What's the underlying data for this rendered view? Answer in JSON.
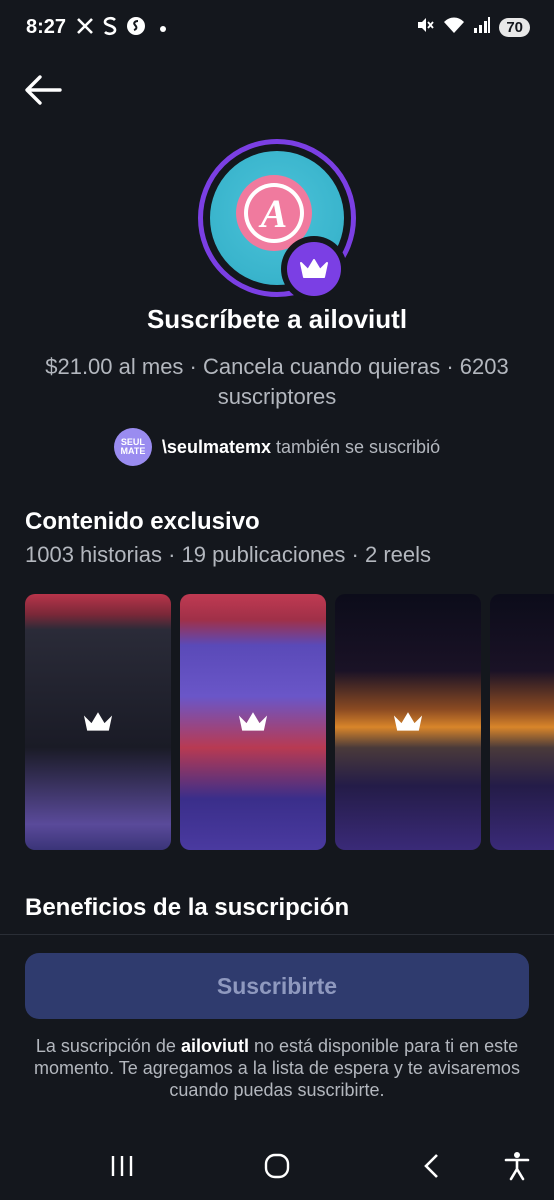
{
  "status_bar": {
    "time": "8:27",
    "left_icons": [
      "x-icon",
      "s-icon",
      "shazam-icon"
    ],
    "battery": "70"
  },
  "header": {
    "back_icon": "arrow-left-icon"
  },
  "profile": {
    "avatar_letter": "A",
    "badge_icon": "crown-icon",
    "title": "Suscríbete a ailoviutl",
    "price_line": "$21.00 al mes · Cancela cuando quieras · 6203 suscriptores",
    "also_subscribed": {
      "avatar_text": "SEUL MATE",
      "user": "\\seulmatemx",
      "text": "también se suscribió"
    }
  },
  "exclusive": {
    "title": "Contenido exclusivo",
    "subtitle": "1003 historias · 19 publicaciones · 2 reels",
    "thumb_icon": "crown-icon"
  },
  "benefits": {
    "title": "Beneficios de la suscripción"
  },
  "cta": {
    "button_label": "Suscribirte",
    "notice_before": "La suscripción de ",
    "notice_user": "ailoviutl",
    "notice_after": " no está disponible para ti en este momento. Te agregamos a la lista de espera y te avisaremos cuando puedas suscribirte."
  },
  "nav_bar": {
    "icons": [
      "recents-icon",
      "home-icon",
      "back-icon",
      "accessibility-icon"
    ]
  },
  "colors": {
    "background": "#14171d",
    "accent_purple": "#7b3fe4",
    "button_bg": "#2f3b6e",
    "secondary_text": "#b3b7be"
  }
}
